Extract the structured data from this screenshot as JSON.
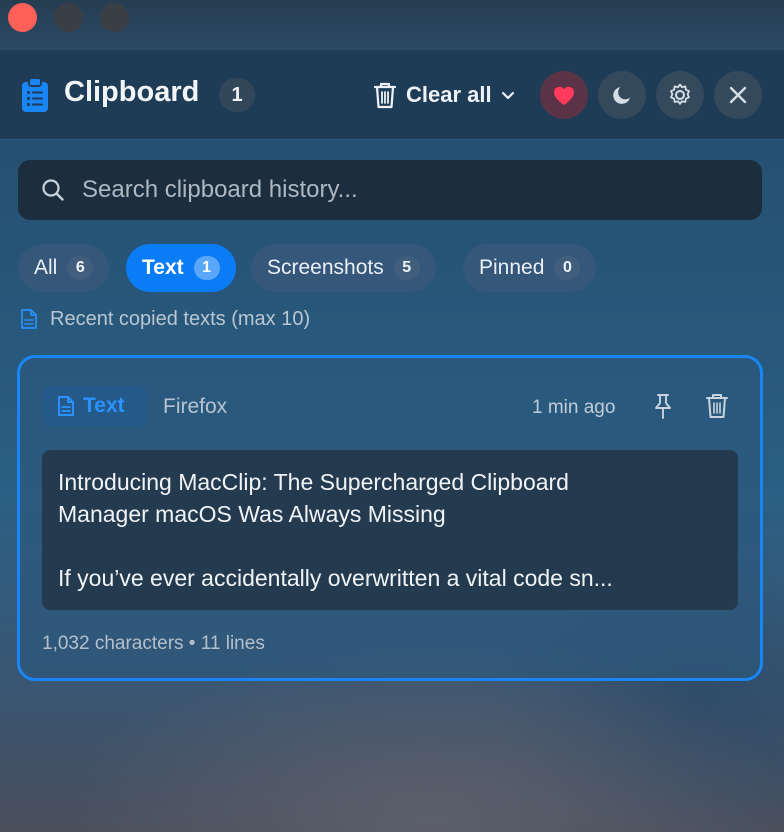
{
  "header": {
    "title": "Clipboard",
    "count": "1",
    "clear_all_label": "Clear all"
  },
  "search": {
    "placeholder": "Search clipboard history..."
  },
  "tabs": [
    {
      "label": "All",
      "count": "6",
      "active": false
    },
    {
      "label": "Text",
      "count": "1",
      "active": true
    },
    {
      "label": "Screenshots",
      "count": "5",
      "active": false
    },
    {
      "label": "Pinned",
      "count": "0",
      "active": false
    }
  ],
  "section_note": "Recent copied texts (max 10)",
  "card": {
    "type_label": "Text",
    "source": "Firefox",
    "time": "1 min ago",
    "preview_lines": [
      "Introducing MacClip: The Supercharged Clipboard",
      "Manager macOS Was Always Missing",
      "",
      "If you’ve ever accidentally overwritten a vital code sn..."
    ],
    "meta": "1,032 characters • 11 lines"
  },
  "colors": {
    "accent": "#0a7cf5",
    "heart": "#ff3b5c",
    "traffic_close": "#fe5f57"
  },
  "icons": [
    "clipboard-icon",
    "trash-icon",
    "chevron-down-icon",
    "heart-icon",
    "moon-icon",
    "gear-icon",
    "close-icon",
    "search-icon",
    "document-icon",
    "pin-icon"
  ]
}
